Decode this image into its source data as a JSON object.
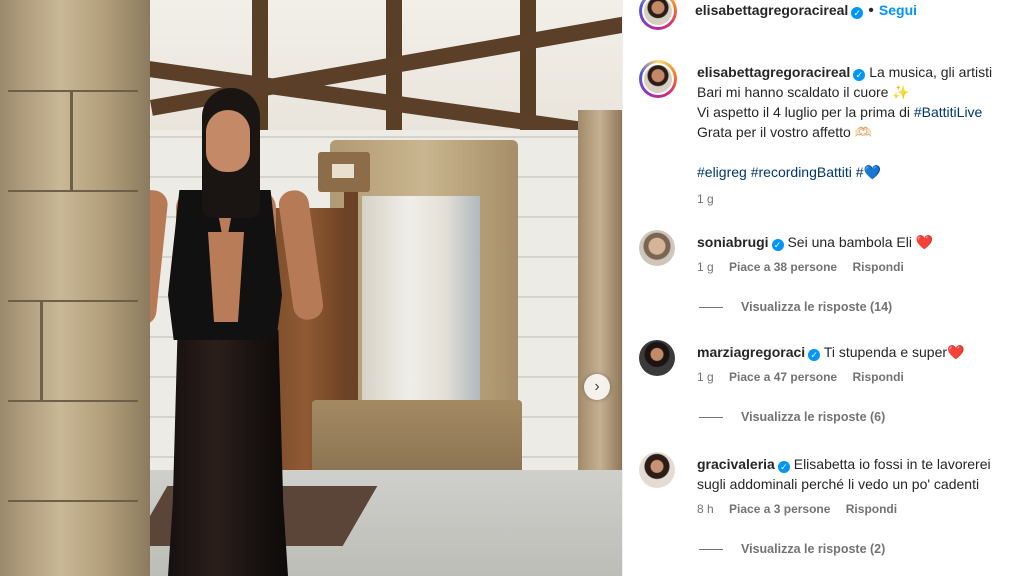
{
  "post": {
    "username": "elisabettagregoracireal",
    "follow_label": "Segui",
    "separator": "•"
  },
  "caption": {
    "username": "elisabettagregoracireal",
    "line1": "La musica, gli artisti",
    "line2": "Bari mi hanno scaldato il cuore ✨",
    "line3_text": "Vi aspetto il 4 luglio per la prima di ",
    "line3_tag": "#BattitiLive",
    "line4": "Grata per il vostro affetto 🫶🏻",
    "tags": [
      "#eligreg",
      "#recordingBattiti",
      "#💙"
    ],
    "time": "1 g"
  },
  "comments": [
    {
      "username": "soniabrugi",
      "text": "Sei una bambola Eli ❤️",
      "time": "1 g",
      "likes": "Piace a 38 persone",
      "reply": "Rispondi",
      "view_replies": "Visualizza le risposte (14)"
    },
    {
      "username": "marziagregoraci",
      "text": "Ti stupenda e super❤️",
      "time": "1 g",
      "likes": "Piace a 47 persone",
      "reply": "Rispondi",
      "view_replies": "Visualizza le risposte (6)"
    },
    {
      "username": "gracivaleria",
      "text": "Elisabetta io fossi in te lavorerei",
      "text2": "sugli addominali perché li vedo un po' cadenti",
      "time": "8 h",
      "likes": "Piace a 3 persone",
      "reply": "Rispondi",
      "view_replies": "Visualizza le risposte (2)"
    }
  ],
  "carousel": {
    "next_label": "›"
  },
  "icons": {
    "verified": "✓",
    "heart": "♡"
  }
}
